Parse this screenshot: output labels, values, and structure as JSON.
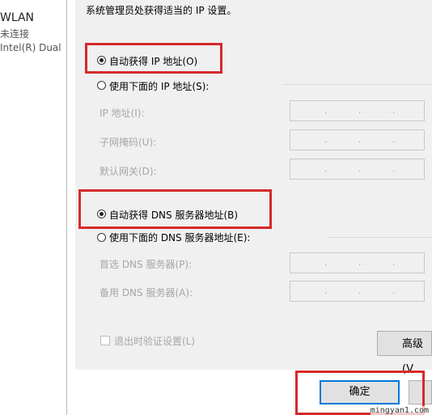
{
  "background_pane": {
    "lines": [
      "WLAN",
      "未连接",
      "Intel(R) Dual"
    ]
  },
  "dialog": {
    "header_text": "系统管理员处获得适当的 IP 设置。",
    "ip_section": {
      "auto_label": "自动获得 IP 地址(O)",
      "auto_checked": true,
      "manual_label": "使用下面的 IP 地址(S):",
      "manual_checked": false,
      "fields": [
        {
          "label": "IP 地址(I):",
          "value": ". . ."
        },
        {
          "label": "子网掩码(U):",
          "value": ". . ."
        },
        {
          "label": "默认网关(D):",
          "value": ". . ."
        }
      ]
    },
    "dns_section": {
      "auto_label": "自动获得 DNS 服务器地址(B)",
      "auto_checked": true,
      "manual_label": "使用下面的 DNS 服务器地址(E):",
      "manual_checked": false,
      "fields": [
        {
          "label": "首选 DNS 服务器(P):",
          "value": ". . ."
        },
        {
          "label": "备用 DNS 服务器(A):",
          "value": ". . ."
        }
      ]
    },
    "validate_label": "退出时验证设置(L)",
    "validate_checked": false,
    "advanced_label": "高级(V",
    "ok_label": "确定"
  },
  "watermark": "mingyan1.com",
  "colors": {
    "highlight": "#d42a2a",
    "dialog_bg": "#f0f0f0",
    "disabled_text": "#a6a6a6",
    "primary_border": "#0078d7"
  }
}
